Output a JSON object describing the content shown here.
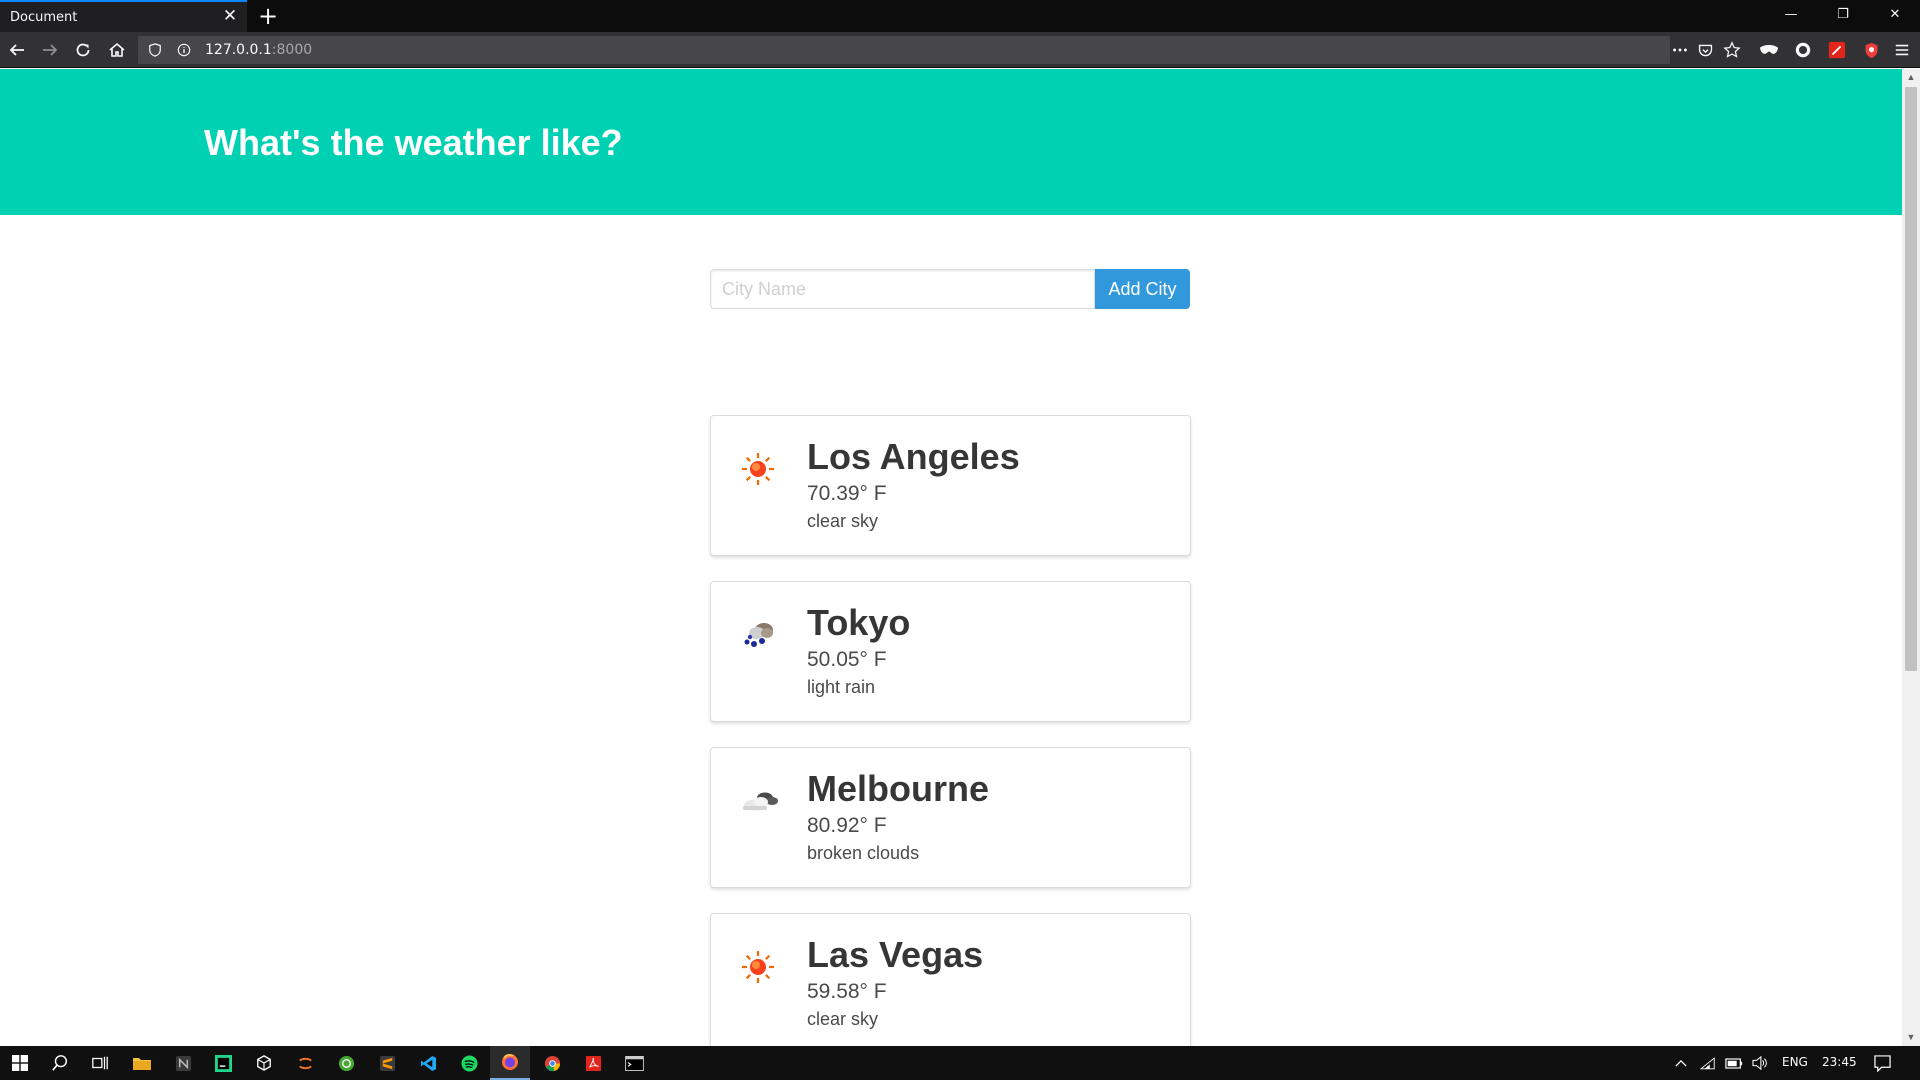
{
  "browser": {
    "tab_title": "Document",
    "tab_close": "✕",
    "new_tab": "+",
    "url_host": "127.0.0.1",
    "url_port": ":8000",
    "window_minimize": "—",
    "window_restore": "❐",
    "window_close": "✕"
  },
  "page": {
    "title": "What's the weather like?",
    "input_placeholder": "City Name",
    "add_button": "Add City"
  },
  "cities": [
    {
      "name": "Los Angeles",
      "temperature": "70.39° F",
      "description": "clear sky",
      "icon": "sun-icon"
    },
    {
      "name": "Tokyo",
      "temperature": "50.05° F",
      "description": "light rain",
      "icon": "rain-icon"
    },
    {
      "name": "Melbourne",
      "temperature": "80.92° F",
      "description": "broken clouds",
      "icon": "cloud-icon"
    },
    {
      "name": "Las Vegas",
      "temperature": "59.58° F",
      "description": "clear sky",
      "icon": "sun-icon"
    }
  ],
  "taskbar": {
    "language": "ENG",
    "time": "23:45"
  },
  "colors": {
    "hero": "#00d1b2",
    "button": "#3298dc"
  }
}
